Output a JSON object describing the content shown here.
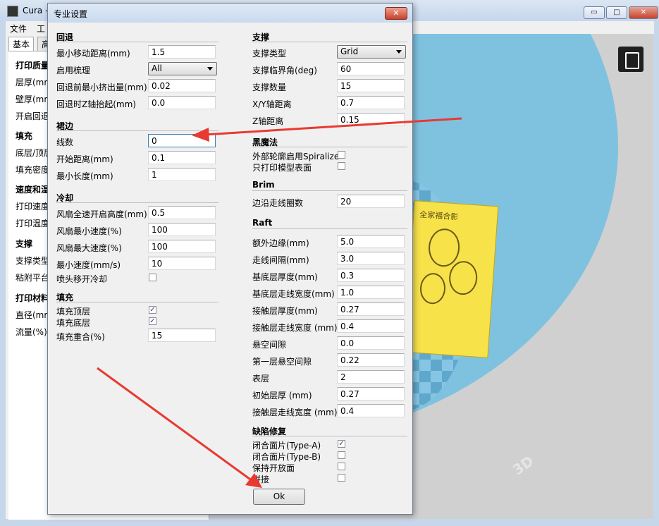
{
  "main_window": {
    "title": "Cura -",
    "menu": [
      "文件",
      "工"
    ],
    "buttons": {
      "minimize": "▭",
      "maximize": "□",
      "close": "✕"
    }
  },
  "left_panel": {
    "tabs": [
      "基本",
      "高"
    ],
    "sections": [
      {
        "title": "打印质量",
        "rows": [
          "层厚(mm",
          "壁厚(mm",
          "开启回退"
        ]
      },
      {
        "title": "填充",
        "rows": [
          "底层/顶层",
          "填充密度"
        ]
      },
      {
        "title": "速度和温",
        "rows": [
          "打印速度",
          "打印温度"
        ]
      },
      {
        "title": "支撑",
        "rows": [
          "支撑类型",
          "粘附平台"
        ]
      },
      {
        "title": "打印材料",
        "rows": [
          "直径(mm",
          "流量(%)"
        ]
      }
    ]
  },
  "viewport": {
    "model_text": "全家福合影"
  },
  "dialog": {
    "title": "专业设置",
    "close": "✕",
    "ok": "Ok",
    "left": {
      "retraction": {
        "title": "回退",
        "min_travel_label": "最小移动距离(mm)",
        "min_travel_value": "1.5",
        "comb_label": "启用梳理",
        "comb_value": "All",
        "min_extrusion_label": "回退前最小挤出量(mm)",
        "min_extrusion_value": "0.02",
        "zhop_label": "回退时Z轴抬起(mm)",
        "zhop_value": "0.0"
      },
      "skirt": {
        "title": "裙边",
        "lines_label": "线数",
        "lines_value": "0",
        "distance_label": "开始距离(mm)",
        "distance_value": "0.1",
        "min_length_label": "最小长度(mm)",
        "min_length_value": "1"
      },
      "cool": {
        "title": "冷却",
        "fan_full_label": "风扇全速开启高度(mm)",
        "fan_full_value": "0.5",
        "fan_min_label": "风扇最小速度(%)",
        "fan_min_value": "100",
        "fan_max_label": "风扇最大速度(%)",
        "fan_max_value": "100",
        "min_speed_label": "最小速度(mm/s)",
        "min_speed_value": "10",
        "head_lift_label": "喷头移开冷却"
      },
      "infill": {
        "title": "填充",
        "top_label": "填充顶层",
        "bottom_label": "填充底层",
        "overlap_label": "填充重合(%)",
        "overlap_value": "15"
      }
    },
    "right": {
      "support": {
        "title": "支撑",
        "type_label": "支撑类型",
        "type_value": "Grid",
        "angle_label": "支撑临界角(deg)",
        "angle_value": "60",
        "amount_label": "支撑数量",
        "amount_value": "15",
        "xy_label": "X/Y轴距离",
        "xy_value": "0.7",
        "z_label": "Z轴距离",
        "z_value": "0.15"
      },
      "black_magic": {
        "title": "黑魔法",
        "spiralize_label": "外部轮廓启用Spiralize",
        "surface_label": "只打印模型表面"
      },
      "brim": {
        "title": "Brim",
        "lines_label": "边沿走线圈数",
        "lines_value": "20"
      },
      "raft": {
        "title": "Raft",
        "rows": [
          {
            "label": "额外边缘(mm)",
            "value": "5.0"
          },
          {
            "label": "走线间隔(mm)",
            "value": "3.0"
          },
          {
            "label": "基底层厚度(mm)",
            "value": "0.3"
          },
          {
            "label": "基底层走线宽度(mm)",
            "value": "1.0"
          },
          {
            "label": "接触层厚度(mm)",
            "value": "0.27"
          },
          {
            "label": "接触层走线宽度 (mm)",
            "value": "0.4"
          },
          {
            "label": "悬空间隙",
            "value": "0.0"
          },
          {
            "label": "第一层悬空间隙",
            "value": "0.22"
          },
          {
            "label": "表层",
            "value": "2"
          },
          {
            "label": "初始层厚 (mm)",
            "value": "0.27"
          },
          {
            "label": "接触层走线宽度 (mm)",
            "value": "0.4"
          }
        ]
      },
      "fix": {
        "title": "缺陷修复",
        "type_a_label": "闭合面片(Type-A)",
        "type_b_label": "闭合面片(Type-B)",
        "keep_open_label": "保持开放面",
        "stitch_label": "拼接"
      }
    },
    "checks": {
      "head_lift": false,
      "infill_top": true,
      "infill_bottom": true,
      "spiralize": false,
      "surface": false,
      "type_a": true,
      "type_b": false,
      "keep_open": false,
      "stitch": false
    }
  },
  "annotation_color": "#e83a30"
}
